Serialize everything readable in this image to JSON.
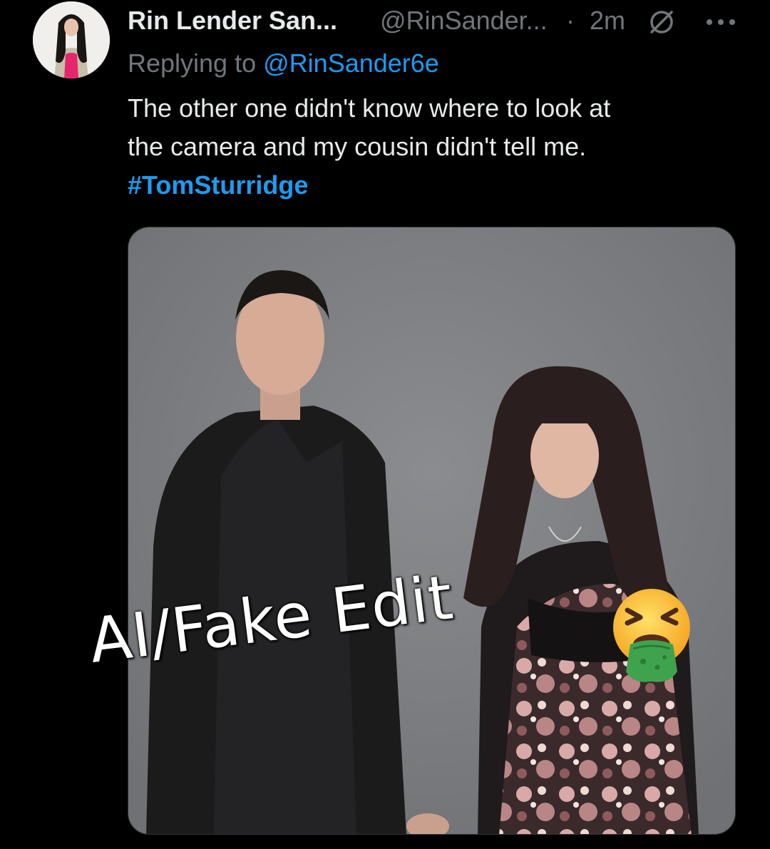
{
  "author": {
    "display_name": "Rin Lender San...",
    "handle": "@RinSander...",
    "separator": "·",
    "time": "2m",
    "avatar_icon": "profile-photo",
    "flag_icon": "no-symbol-icon",
    "more_icon": "more-horizontal-icon"
  },
  "reply": {
    "prefix": "Replying to",
    "handle": "@RinSander6e"
  },
  "tweet": {
    "line1": "The other one didn't know where to look at",
    "line2": "the camera and my cousin didn't tell me.",
    "hashtag": "#TomSturridge"
  },
  "media": {
    "overlay_text": "AI/Fake Edit",
    "overlay_emoji": "face-vomiting-emoji"
  },
  "colors": {
    "background": "#000000",
    "text_primary": "#e7e9ea",
    "text_secondary": "#71767b",
    "link": "#1d9bf0"
  }
}
